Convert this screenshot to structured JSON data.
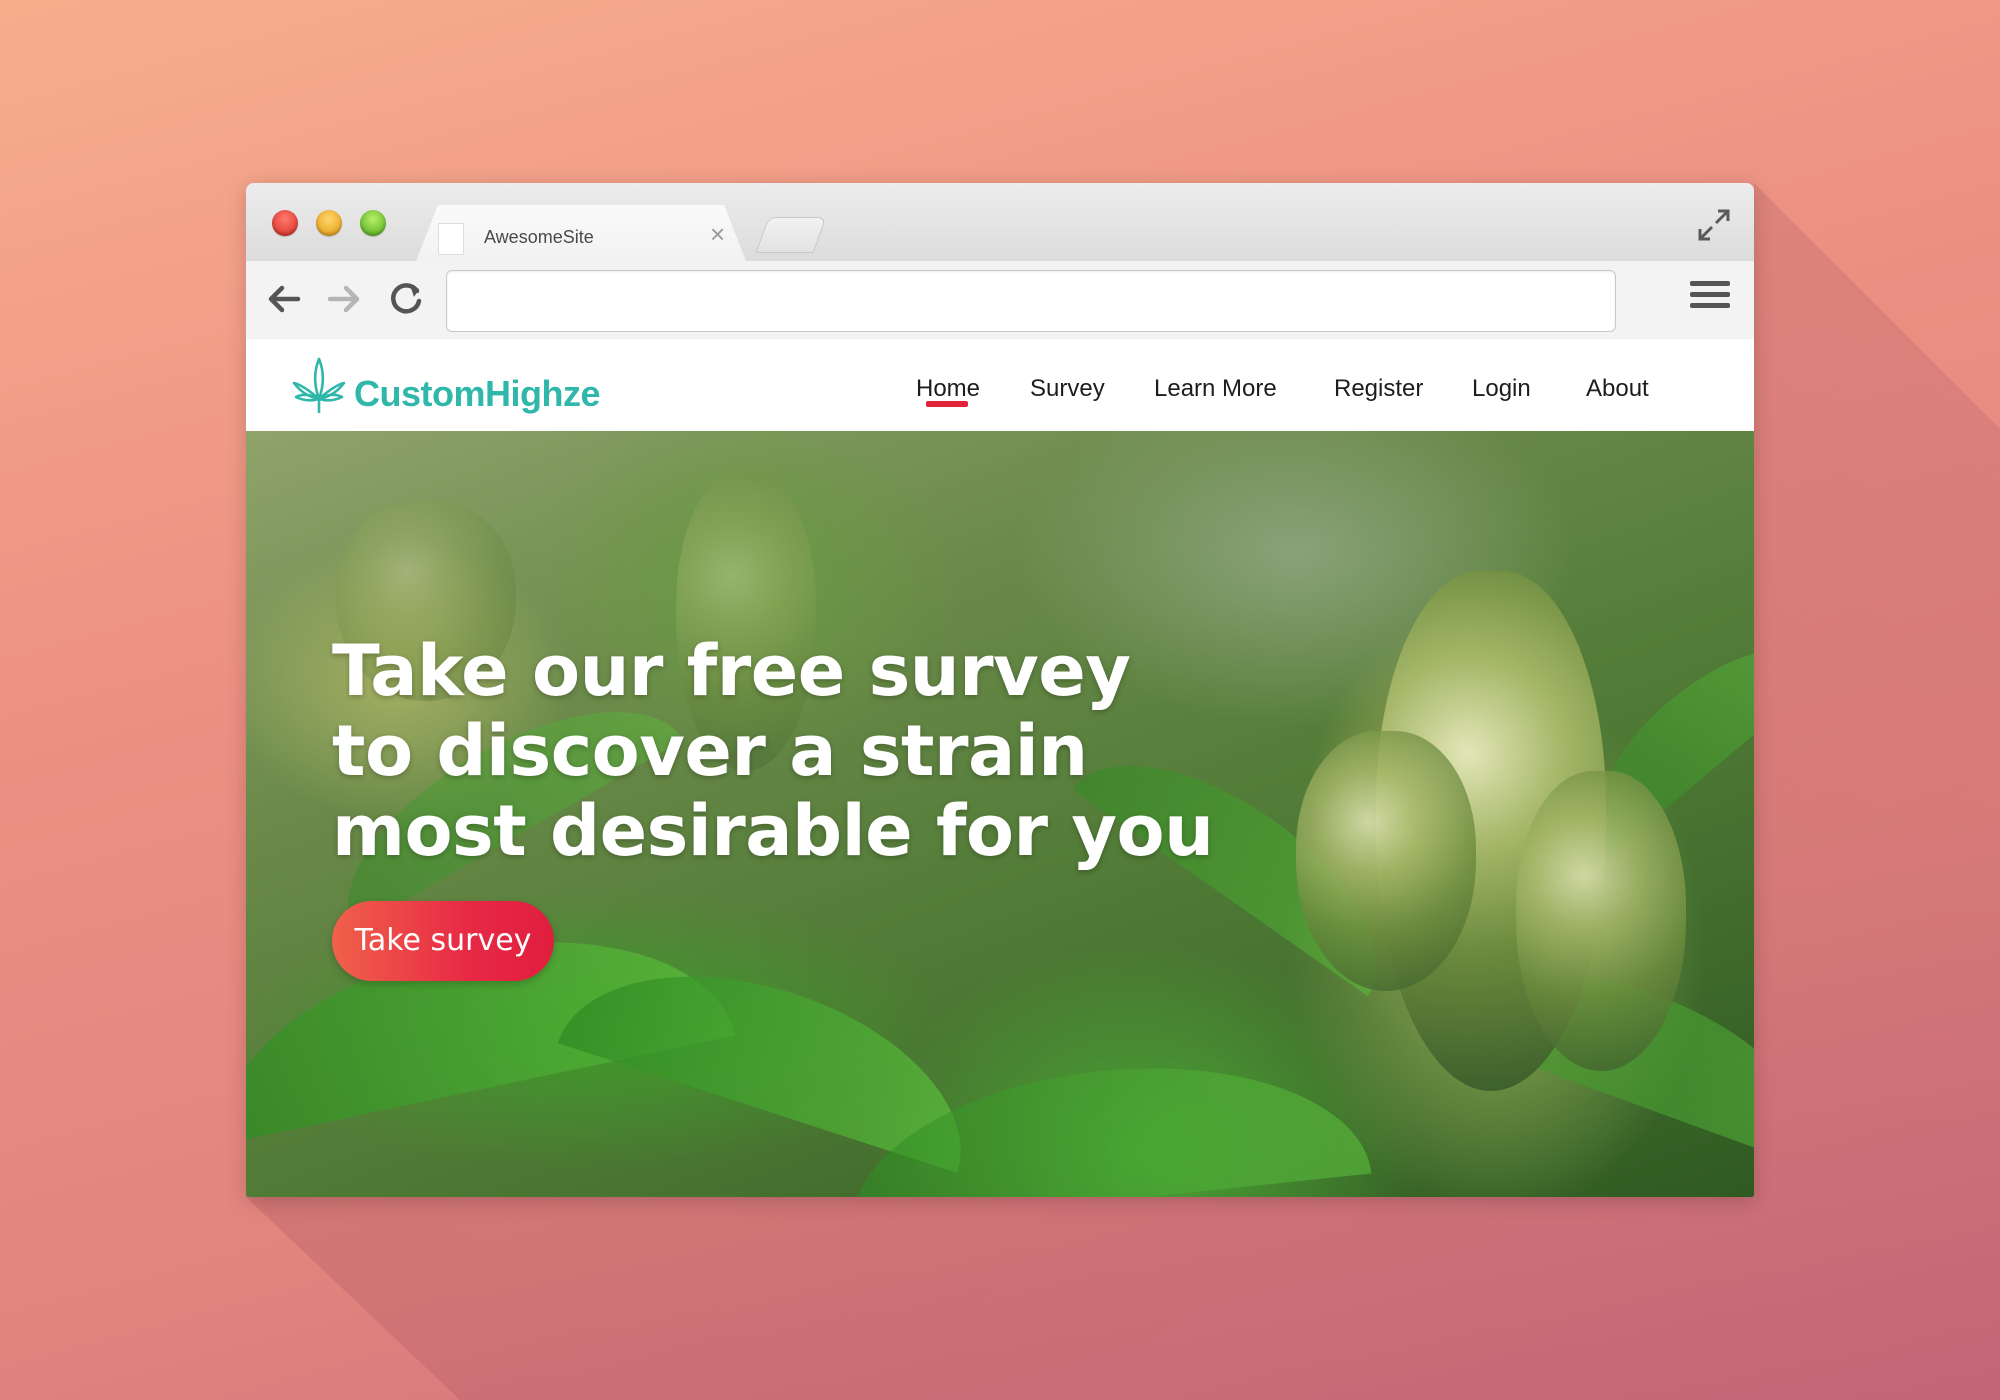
{
  "browser": {
    "tab_title": "AwesomeSite",
    "tab_close": "×",
    "address_value": ""
  },
  "site": {
    "logo_text": "CustomHighze",
    "nav": [
      {
        "label": "Home",
        "active": true
      },
      {
        "label": "Survey"
      },
      {
        "label": "Learn More"
      },
      {
        "label": "Register"
      },
      {
        "label": "Login"
      },
      {
        "label": "About"
      }
    ]
  },
  "hero": {
    "title_lines": [
      "Take our free survey",
      "to discover a strain",
      "most desirable for you"
    ],
    "cta_label": "Take survey"
  },
  "colors": {
    "accent": "#e2223a",
    "brand": "#2fb7aa",
    "cta_start": "#f0614a",
    "cta_end": "#e01e3e"
  },
  "icons": {
    "back": "arrow-left-icon",
    "forward": "arrow-right-icon",
    "reload": "reload-icon",
    "menu": "hamburger-menu-icon",
    "expand": "expand-icon",
    "logo": "cannabis-leaf-icon"
  }
}
